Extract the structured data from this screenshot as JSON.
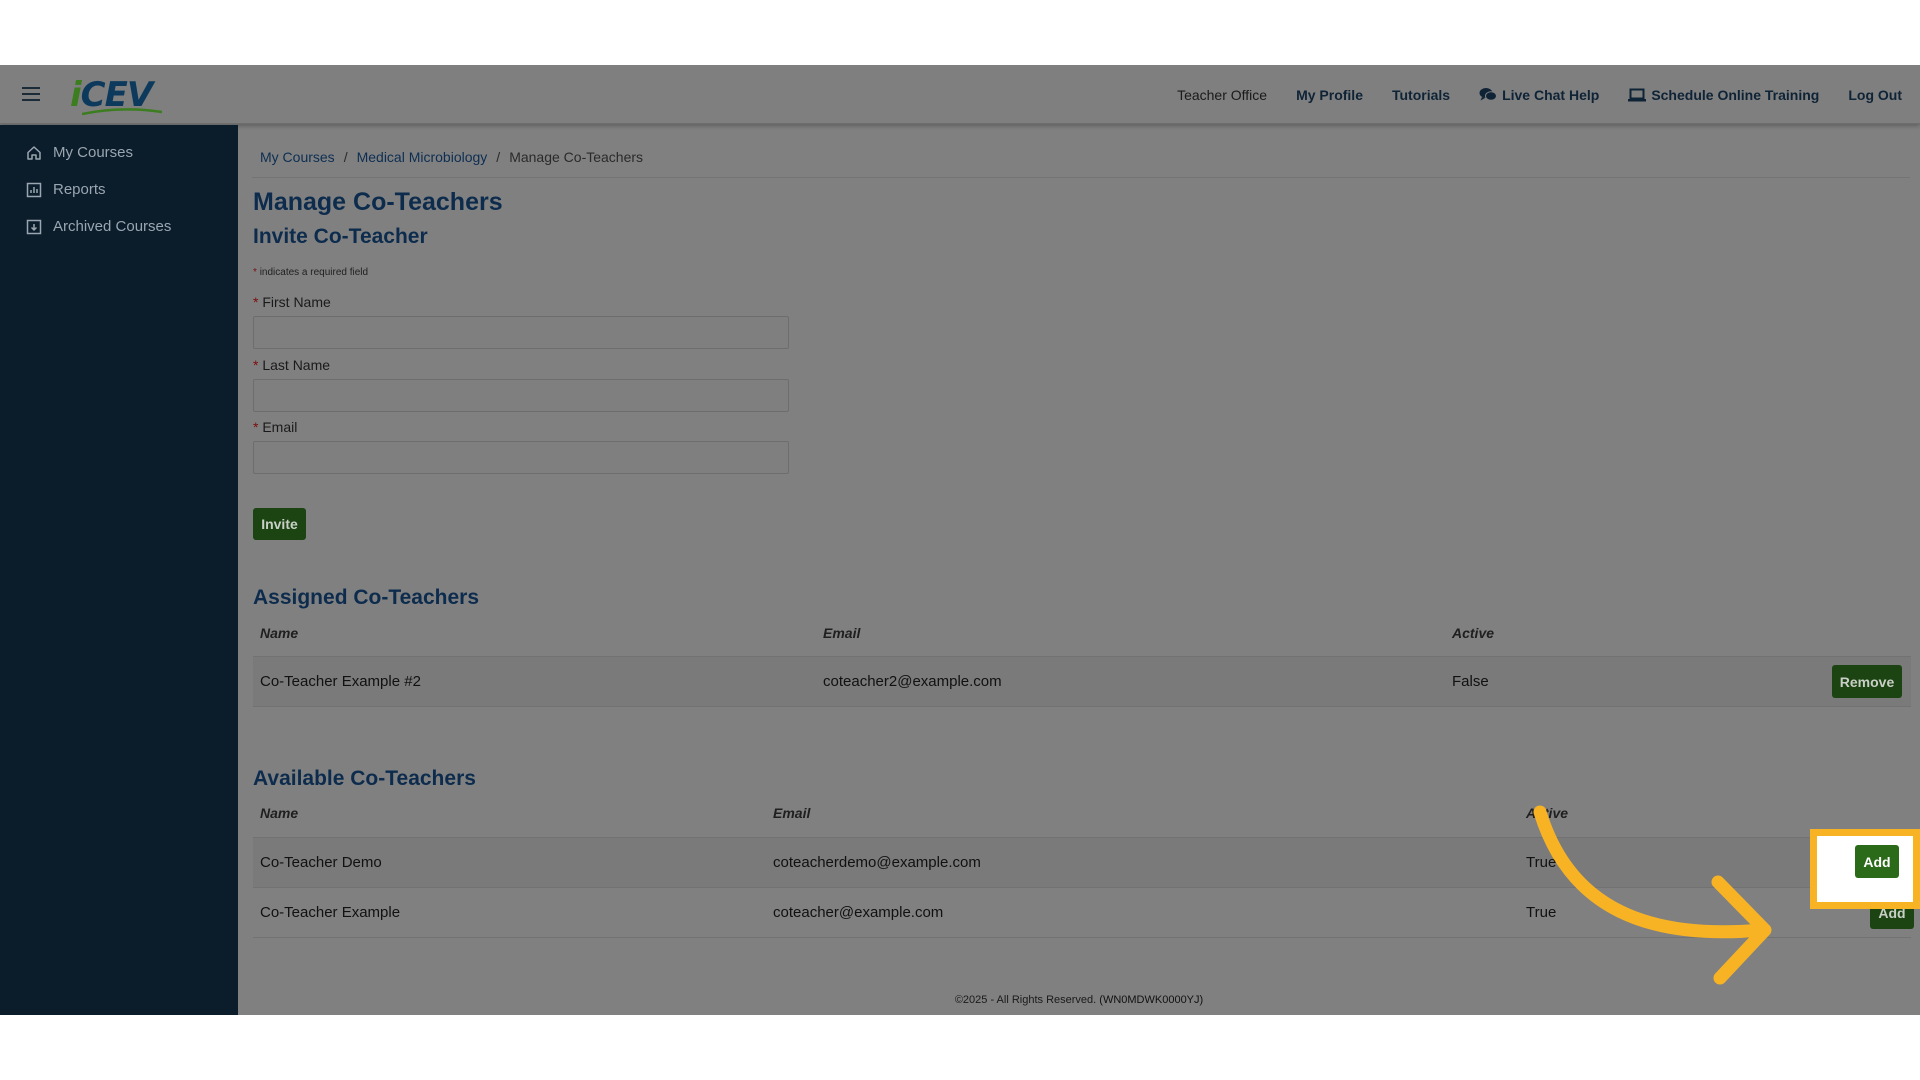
{
  "header": {
    "logo_text": "iCEV",
    "nav": [
      {
        "label": "Teacher Office"
      },
      {
        "label": "My Profile"
      },
      {
        "label": "Tutorials"
      },
      {
        "label": "Live Chat Help",
        "icon": "chat-icon"
      },
      {
        "label": "Schedule Online Training",
        "icon": "laptop-icon"
      },
      {
        "label": "Log Out"
      }
    ]
  },
  "sidebar": {
    "items": [
      {
        "label": "My Courses",
        "icon": "home-icon"
      },
      {
        "label": "Reports",
        "icon": "chart-icon"
      },
      {
        "label": "Archived Courses",
        "icon": "archive-icon"
      }
    ]
  },
  "breadcrumb": {
    "items": [
      "My Courses",
      "Medical Microbiology",
      "Manage Co-Teachers"
    ],
    "separator": "/"
  },
  "page": {
    "title": "Manage Co-Teachers",
    "invite_heading": "Invite Co-Teacher",
    "required_star": "*",
    "required_note": "indicates a required field",
    "fields": {
      "first_name": {
        "label": "First Name",
        "value": ""
      },
      "last_name": {
        "label": "Last Name",
        "value": ""
      },
      "email": {
        "label": "Email",
        "value": ""
      }
    },
    "invite_button": "Invite"
  },
  "assigned": {
    "heading": "Assigned Co-Teachers",
    "columns": [
      "Name",
      "Email",
      "Active"
    ],
    "rows": [
      {
        "name": "Co-Teacher Example #2",
        "email": "coteacher2@example.com",
        "active": "False",
        "action": "Remove"
      }
    ]
  },
  "available": {
    "heading": "Available Co-Teachers",
    "columns": [
      "Name",
      "Email",
      "Active"
    ],
    "rows": [
      {
        "name": "Co-Teacher Demo",
        "email": "coteacherdemo@example.com",
        "active": "True",
        "action": "Add"
      },
      {
        "name": "Co-Teacher Example",
        "email": "coteacher@example.com",
        "active": "True",
        "action": "Add"
      }
    ]
  },
  "footer": {
    "text": "©2025 - All Rights Reserved.",
    "code": "(WN0MDWK0000YJ)"
  },
  "colors": {
    "highlight": "#f7b324",
    "button_green": "#1b4412",
    "sidebar_bg": "#0b1c2b",
    "heading_blue": "#0d2c4d"
  }
}
